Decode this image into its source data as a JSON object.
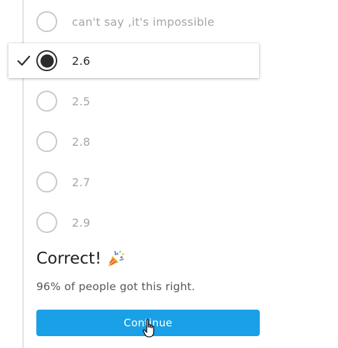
{
  "options": [
    {
      "label": "can't say ,it's impossible",
      "selected": false
    },
    {
      "label": "2.6",
      "selected": true
    },
    {
      "label": "2.5",
      "selected": false
    },
    {
      "label": "2.8",
      "selected": false
    },
    {
      "label": "2.7",
      "selected": false
    },
    {
      "label": "2.9",
      "selected": false
    }
  ],
  "result": {
    "title": "Correct!",
    "emoji_icon": "party-popper-icon",
    "subtitle": "96% of people got this right."
  },
  "continue_button": {
    "label": "Continue"
  },
  "colors": {
    "accent": "#1aa0e6",
    "selected_dark": "#2b2b2b",
    "muted_text": "#a5a5a5"
  },
  "icons": {
    "selected_marker": "checkmark-icon",
    "pointer": "hand-pointer-cursor-icon"
  }
}
